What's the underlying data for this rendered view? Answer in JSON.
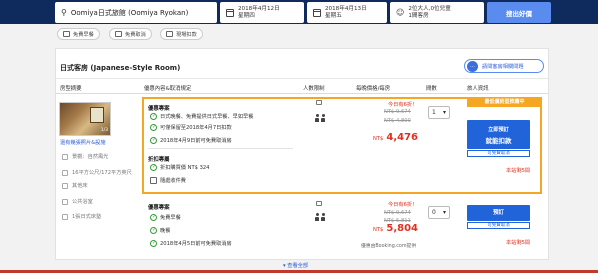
{
  "search": {
    "hotel": "Oomiya日式旅館 (Oomiya Ryokan)",
    "checkin": "2018年4月12日",
    "checkin_day": "星期四",
    "checkout": "2018年4月13日",
    "checkout_day": "星期五",
    "guests": "2位大人,0位兒童",
    "rooms": "1間客房",
    "button": "搜出好價"
  },
  "filters": [
    "免費早餐",
    "免費取消",
    "現場扣款"
  ],
  "room": {
    "title": "日式客房 (Japanese-Style Room)",
    "chat_button": "請問客房相關問題",
    "headers": {
      "type": "房型摘要",
      "offers": "優惠內容&取消規定",
      "persons": "人數限制",
      "price": "每晚價格/每房",
      "rooms": "間數",
      "info": "旅人資訊"
    },
    "photo_pages": "1/3",
    "link": "還有幾張照片&設施",
    "amenities": [
      "景觀：自然風光",
      "16平方公尺/172平方英尺",
      "其他床",
      "公共浴室",
      "1張日式床墊"
    ]
  },
  "offer1": {
    "section1": "優惠專案",
    "items": [
      "日式晚餐、免費提供日式早餐、早如早餐",
      "可僅保留至2018年4月7日扣款",
      "2018年4月9日前可免費取消房"
    ],
    "section2": "折扣專屬",
    "items2": [
      "折扣購買價 NT$ 324",
      "隨處收件費"
    ],
    "badge": "今日有6折！",
    "old_price": "NT$ 9,674",
    "old_price2": "NT$ 4,800",
    "price_prefix": "NT$",
    "price": "4,476",
    "qty": "1",
    "banner": "最低價房型推薦中",
    "book_top": "立即預訂",
    "book_bottom": "就能扣款",
    "cancel_note": "可免費取消",
    "remaining": "本站剩5間"
  },
  "offer2": {
    "section1": "優惠專案",
    "items": [
      "免費早餐",
      "晚餐",
      "2018年4月5日前可免費取消房"
    ],
    "badge": "今日有6折！",
    "old_price": "NT$ 9,674",
    "old_price2": "NT$ 5,811",
    "price_prefix": "NT$",
    "price": "5,804",
    "qty": "0",
    "note": "優惠由Booking.com提供",
    "book": "預訂",
    "cancel_note": "可免費取消",
    "remaining": "本站剩5間"
  },
  "show_all": "查看全部",
  "colors": {
    "header_bg": "#0f2a5c",
    "accent": "#2163d8",
    "price_red": "#e0301e",
    "highlight": "#f5a623"
  }
}
